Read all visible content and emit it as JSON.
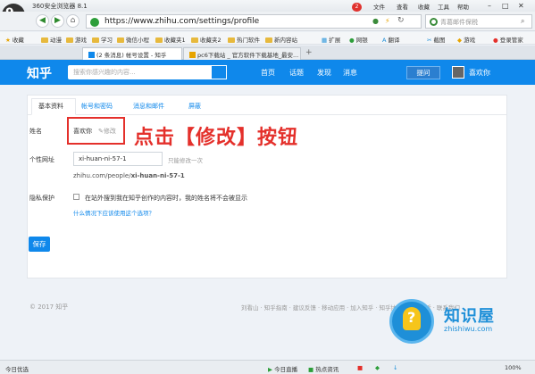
{
  "browser": {
    "app_title": "360安全浏览器 8.1",
    "menu": [
      "文件",
      "查看",
      "收藏",
      "工具",
      "帮助"
    ],
    "url": "https://www.zhihu.com/settings/profile",
    "search_placeholder": "青葛邮件保税",
    "favorites": [
      "收藏",
      "动漫",
      "游戏",
      "学习",
      "微信小程",
      "收藏夹1",
      "收藏夹2",
      "热门软件",
      "新内容站",
      "扩展",
      "网银",
      "翻译",
      "截图",
      "游戏",
      "登录管家"
    ],
    "tabs": [
      {
        "label": "(2 条消息) 帐号设置 - 知乎",
        "active": true
      },
      {
        "label": "pc6下载站 _ 官方软件下载基地_最安...",
        "active": false
      }
    ],
    "tab_add": "+",
    "status": {
      "left": "今日优选",
      "items": [
        "今日直播",
        "热点资讯",
        "",
        "",
        "",
        ""
      ],
      "zoom": "100%"
    }
  },
  "zhihu": {
    "logo": "知乎",
    "search_placeholder": "搜索你感兴趣的内容...",
    "nav": [
      "首页",
      "话题",
      "发现",
      "消息"
    ],
    "badge": "2",
    "ask_label": "提问",
    "user_name": "喜欢你"
  },
  "settings": {
    "tabs": [
      "基本资料",
      "帐号和密码",
      "消息和邮件",
      "屏蔽"
    ],
    "name_label": "姓名",
    "name_value": "喜欢你",
    "edit_label": "修改",
    "url_label": "个性网址",
    "url_input": "xi-huan-ni-57-1",
    "url_hint": "只能修改一次",
    "url_preview_prefix": "zhihu.com/people/",
    "url_preview_slug": "xi-huan-ni-57-1",
    "privacy_label": "隐私保护",
    "privacy_option": "在站外搜到我在知乎创作的内容时，我的姓名将不会被显示",
    "privacy_link": "什么情况下应该使用这个选项？",
    "save_label": "保存"
  },
  "annotation": "点击【修改】按钮",
  "footer": {
    "copyright": "© 2017 知乎",
    "links": "刘看山 · 知乎指南 · 建议反馈 · 移动应用 · 加入知乎 · 知乎协议 · 举报投诉 · 联系我们"
  },
  "watermark": {
    "title": "知识屋",
    "subtitle": "zhishiwu.com"
  },
  "colors": {
    "zhihu_blue": "#0f88eb",
    "annotation_red": "#e4302b"
  }
}
